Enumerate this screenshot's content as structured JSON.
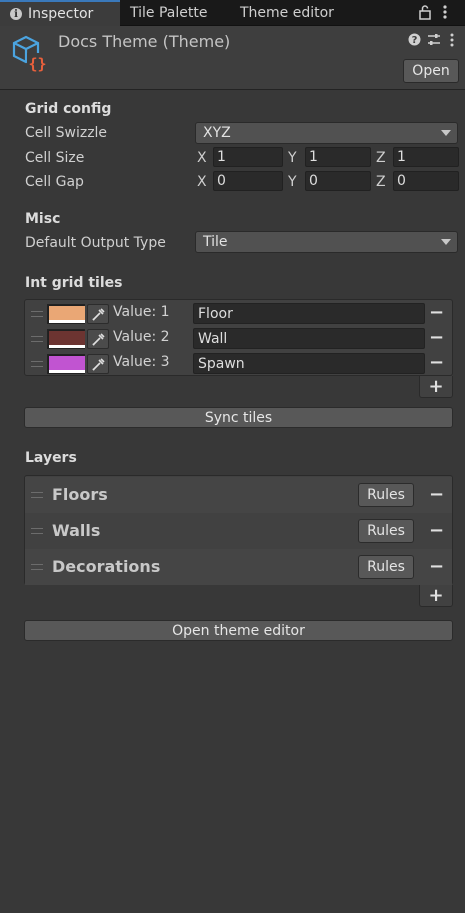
{
  "tabs": [
    {
      "label": "Inspector",
      "active": true
    },
    {
      "label": "Tile Palette",
      "active": false
    },
    {
      "label": "Theme editor",
      "active": false
    }
  ],
  "header": {
    "title": "Docs Theme (Theme)",
    "open_label": "Open",
    "icon": "theme-asset-icon",
    "icon_colors": {
      "cube": "#4ba4e0",
      "braces": "#e8603c"
    }
  },
  "grid_config": {
    "heading": "Grid config",
    "cell_swizzle_label": "Cell Swizzle",
    "cell_swizzle_value": "XYZ",
    "cell_size_label": "Cell Size",
    "cell_size": {
      "x": "1",
      "y": "1",
      "z": "1"
    },
    "cell_gap_label": "Cell Gap",
    "cell_gap": {
      "x": "0",
      "y": "0",
      "z": "0"
    },
    "axis_labels": {
      "x": "X",
      "y": "Y",
      "z": "Z"
    }
  },
  "misc": {
    "heading": "Misc",
    "output_type_label": "Default Output Type",
    "output_type_value": "Tile"
  },
  "int_grid_tiles": {
    "heading": "Int grid tiles",
    "tiles": [
      {
        "value_label": "Value: 1",
        "name": "Floor",
        "color": "#eaa775"
      },
      {
        "value_label": "Value: 2",
        "name": "Wall",
        "color": "#6c3431"
      },
      {
        "value_label": "Value: 3",
        "name": "Spawn",
        "color": "#c154d1"
      }
    ],
    "sync_label": "Sync tiles"
  },
  "layers": {
    "heading": "Layers",
    "items": [
      {
        "name": "Floors",
        "rules_label": "Rules"
      },
      {
        "name": "Walls",
        "rules_label": "Rules"
      },
      {
        "name": "Decorations",
        "rules_label": "Rules"
      }
    ]
  },
  "footer": {
    "open_theme_editor_label": "Open theme editor"
  },
  "icons": {
    "minus": "−",
    "plus": "+"
  }
}
